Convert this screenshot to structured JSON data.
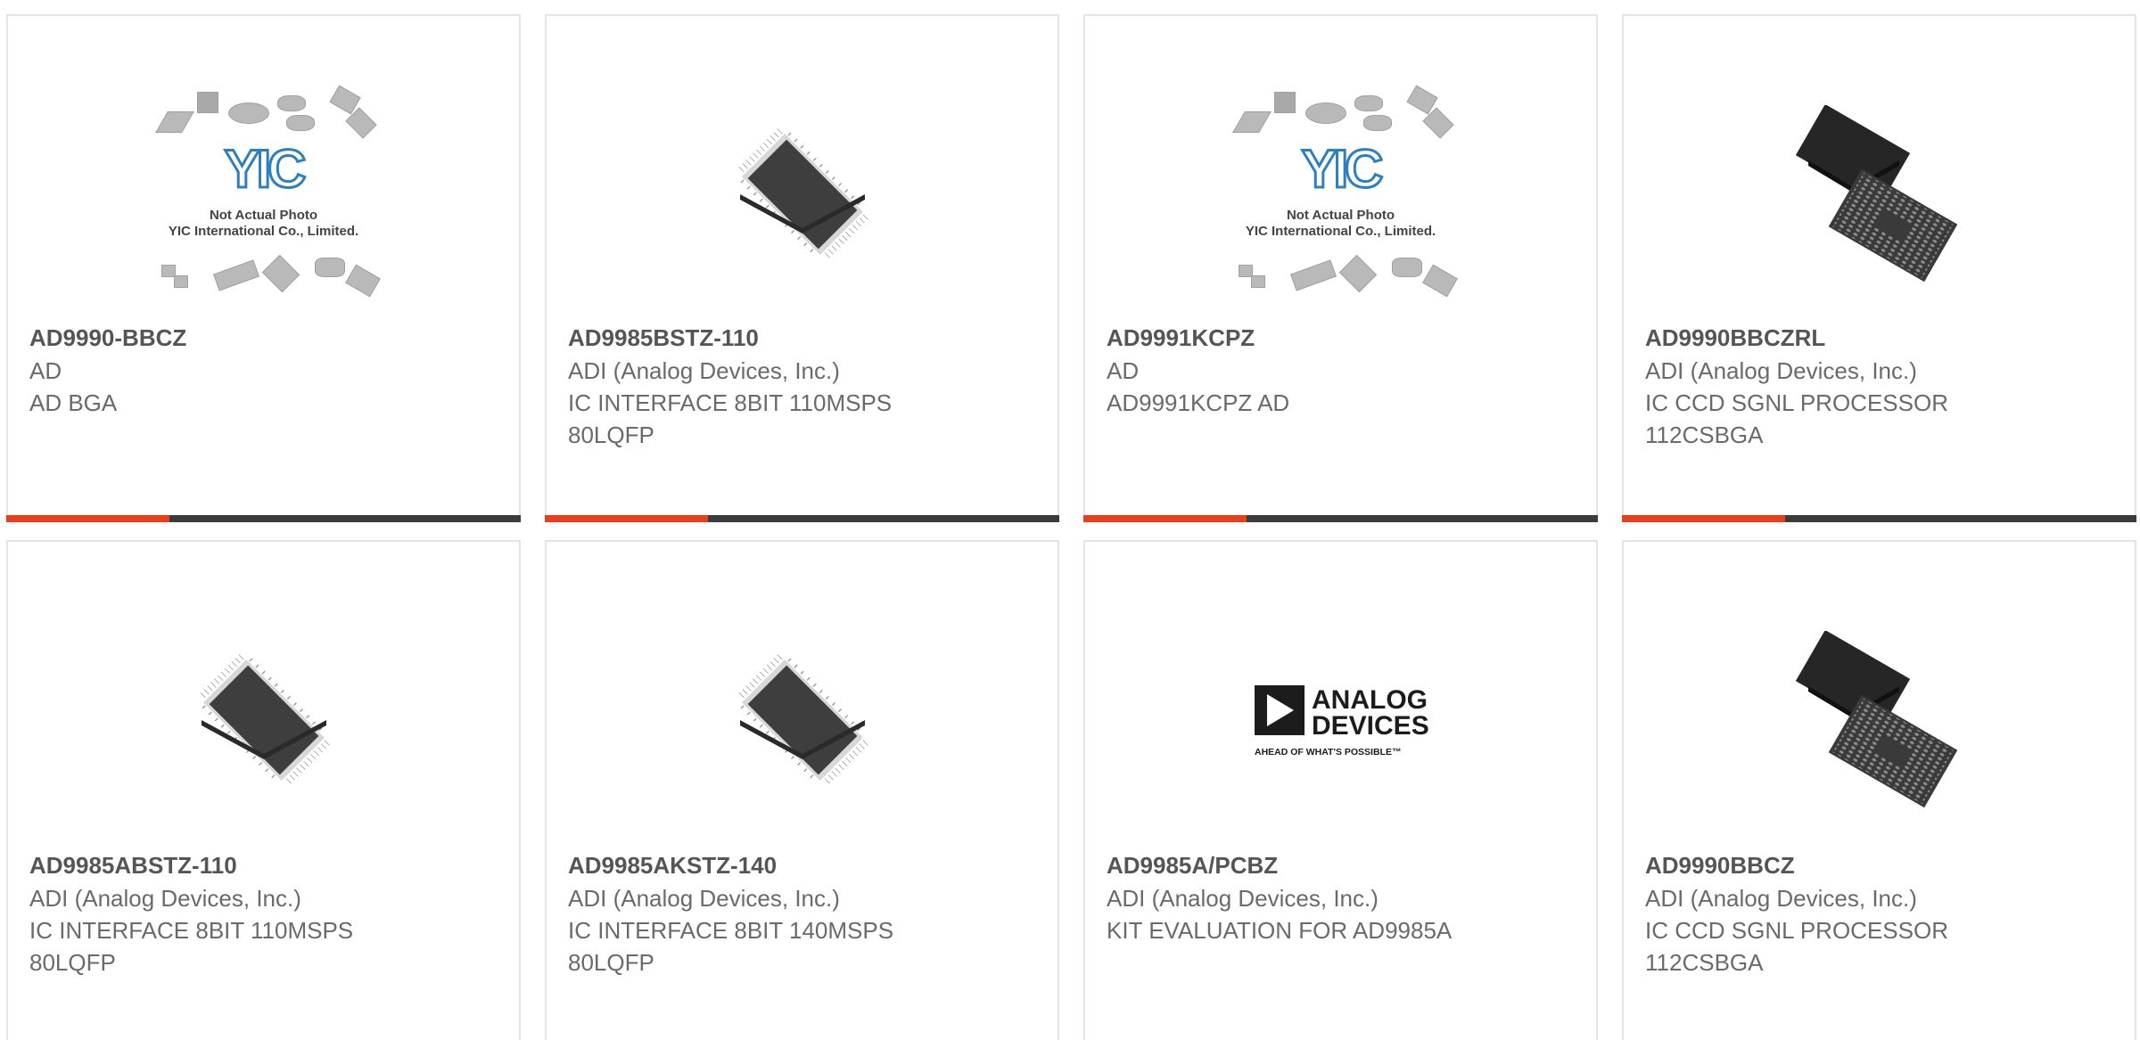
{
  "colors": {
    "accent": "#e8401c",
    "bar": "#3b3b3b",
    "border": "#e4e4e4"
  },
  "placeholder": {
    "logo": "YIC",
    "line1": "Not Actual Photo",
    "line2": "YIC International Co., Limited."
  },
  "adi_logo": {
    "line1": "ANALOG",
    "line2": "DEVICES",
    "tagline": "AHEAD OF WHAT'S POSSIBLE™"
  },
  "products": [
    {
      "part": "AD9990-BBCZ",
      "manufacturer": "AD",
      "description": "AD BGA",
      "image": "placeholder-photo"
    },
    {
      "part": "AD9985BSTZ-110",
      "manufacturer": "ADI (Analog Devices, Inc.)",
      "description": "IC INTERFACE 8BIT 110MSPS 80LQFP",
      "image": "lqfp-chip"
    },
    {
      "part": "AD9991KCPZ",
      "manufacturer": "AD",
      "description": "AD9991KCPZ AD",
      "image": "placeholder-photo"
    },
    {
      "part": "AD9990BBCZRL",
      "manufacturer": "ADI (Analog Devices, Inc.)",
      "description": "IC CCD SGNL PROCESSOR 112CSBGA",
      "image": "bga-chip"
    },
    {
      "part": "AD9985ABSTZ-110",
      "manufacturer": "ADI (Analog Devices, Inc.)",
      "description": "IC INTERFACE 8BIT 110MSPS 80LQFP",
      "image": "lqfp-chip"
    },
    {
      "part": "AD9985AKSTZ-140",
      "manufacturer": "ADI (Analog Devices, Inc.)",
      "description": "IC INTERFACE 8BIT 140MSPS 80LQFP",
      "image": "lqfp-chip"
    },
    {
      "part": "AD9985A/PCBZ",
      "manufacturer": "ADI (Analog Devices, Inc.)",
      "description": "KIT EVALUATION FOR AD9985A",
      "image": "analog-devices-logo"
    },
    {
      "part": "AD9990BBCZ",
      "manufacturer": "ADI (Analog Devices, Inc.)",
      "description": "IC CCD SGNL PROCESSOR 112CSBGA",
      "image": "bga-chip"
    }
  ]
}
